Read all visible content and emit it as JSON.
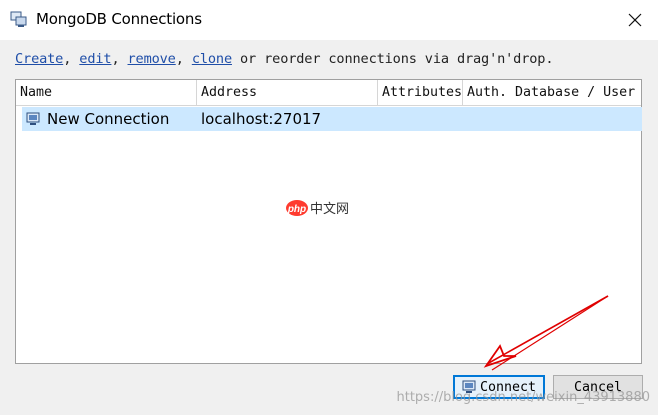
{
  "window": {
    "title": "MongoDB Connections",
    "close_symbol": "✕"
  },
  "instructions": {
    "create": "Create",
    "sep1": ", ",
    "edit": "edit",
    "sep2": ", ",
    "remove": "remove",
    "sep3": ", ",
    "clone": "clone",
    "rest": " or reorder connections via drag'n'drop."
  },
  "table": {
    "columns": [
      "Name",
      "Address",
      "Attributes",
      "Auth. Database / User"
    ],
    "rows": [
      {
        "name": "New Connection",
        "address": "localhost:27017",
        "attributes": "",
        "auth": ""
      }
    ]
  },
  "buttons": {
    "connect": "Connect",
    "cancel": "Cancel"
  },
  "watermark": {
    "logo_text": "php",
    "logo_cn": "中文网",
    "url": "https://blog.csdn.net/weixin_43913880"
  },
  "colors": {
    "selection": "#cce8ff",
    "link": "#1f4ea8",
    "focus_border": "#0078d7",
    "annotation_arrow": "#e00000"
  }
}
